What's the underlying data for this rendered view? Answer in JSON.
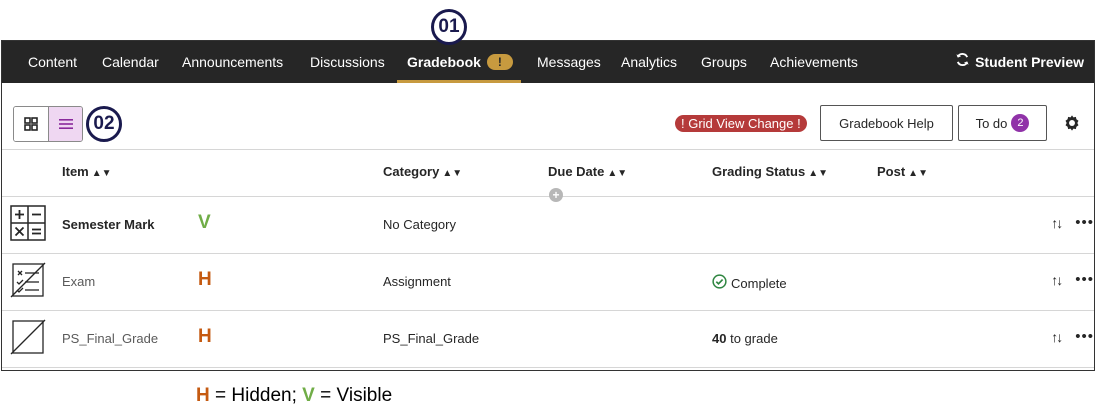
{
  "callouts": {
    "nav": "01",
    "toggle": "02"
  },
  "nav": {
    "items": [
      {
        "label": "Content"
      },
      {
        "label": "Calendar"
      },
      {
        "label": "Announcements"
      },
      {
        "label": "Discussions"
      },
      {
        "label": "Gradebook",
        "badge": "!"
      },
      {
        "label": "Messages"
      },
      {
        "label": "Analytics"
      },
      {
        "label": "Groups"
      },
      {
        "label": "Achievements"
      }
    ],
    "active": "Gradebook",
    "student_preview": "Student Preview"
  },
  "toolbar": {
    "grid_view_change": "! Grid View Change !",
    "help_label": "Gradebook Help",
    "todo_label": "To do",
    "todo_count": "2"
  },
  "columns": {
    "item": "Item",
    "category": "Category",
    "due_date": "Due Date",
    "grading_status": "Grading Status",
    "post": "Post"
  },
  "rows": [
    {
      "item": "Semester Mark",
      "visibility": "V",
      "category": "No Category",
      "status": "",
      "icon": "calculation-icon"
    },
    {
      "item": "Exam",
      "visibility": "H",
      "category": "Assignment",
      "status": "Complete",
      "icon": "assignment-hidden-icon"
    },
    {
      "item": "PS_Final_Grade",
      "visibility": "H",
      "category": "PS_Final_Grade",
      "status_count": "40",
      "status_suffix": "to grade",
      "icon": "manual-column-hidden-icon"
    }
  ],
  "legend": {
    "h": "H",
    "h_text": "= Hidden;",
    "v": "V",
    "v_text": "= Visible"
  },
  "colors": {
    "nav_bg": "#262626",
    "accent_gold": "#c79a3f",
    "hidden": "#c55a11",
    "visible": "#70ad47",
    "alert_red": "#b53a3a",
    "todo_purple": "#9032a8",
    "toggle_selected": "#efd7f2"
  }
}
